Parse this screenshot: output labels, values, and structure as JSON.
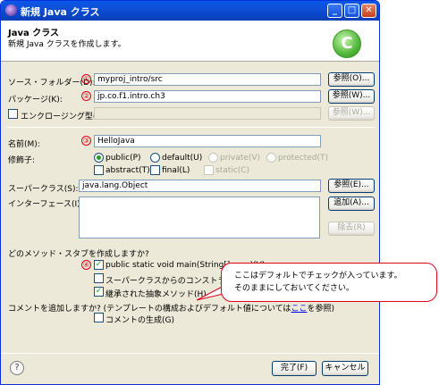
{
  "window": {
    "title": "新規 Java クラス",
    "controls": {
      "minimize": "_",
      "maximize": "□",
      "close": "✕"
    }
  },
  "header": {
    "title": "Java クラス",
    "subtitle": "新規 Java クラスを作成します。",
    "logo_letter": "C"
  },
  "markers": [
    "①",
    "②",
    "③",
    "④"
  ],
  "source_folder": {
    "label": "ソース・フォルダー(D):",
    "value": "myproj_intro/src",
    "browse": "参照(O)..."
  },
  "package": {
    "label": "パッケージ(K):",
    "value": "jp.co.f1.intro.ch3",
    "browse": "参照(W)..."
  },
  "enclosing_type": {
    "label": "エンクロージング型(Y):",
    "value": "",
    "browse": "参照(W)..."
  },
  "name": {
    "label": "名前(M):",
    "value": "HelloJava"
  },
  "modifiers": {
    "label": "修飾子:",
    "public": "public(P)",
    "default": "default(U)",
    "private": "private(V)",
    "protected": "protected(T)",
    "abstract": "abstract(T)",
    "final": "final(L)",
    "static": "static(C)"
  },
  "superclass": {
    "label": "スーパークラス(S):",
    "value": "java.lang.Object",
    "browse": "参照(E)..."
  },
  "interfaces": {
    "label": "インターフェース(I):",
    "add": "追加(A)...",
    "remove": "除去(R)"
  },
  "stubs": {
    "question": "どのメソッド・スタブを作成しますか?",
    "main": "public static void main(String[] args)(V)",
    "constructors": "スーパークラスからのコンストラクター(C)",
    "inherited": "継承された抽象メソッド(H)"
  },
  "comments": {
    "question": "コメントを追加しますか? (テンプレートの構成およびデフォルト値については",
    "link": "ここ",
    "suffix": "を参照)",
    "option": "コメントの生成(G)"
  },
  "buttons": {
    "help": "?",
    "finish": "完了(F)",
    "cancel": "キャンセル"
  },
  "callout": {
    "line1": "ここはデフォルトでチェックが入っています。",
    "line2": "そのままにしておいてください。"
  }
}
